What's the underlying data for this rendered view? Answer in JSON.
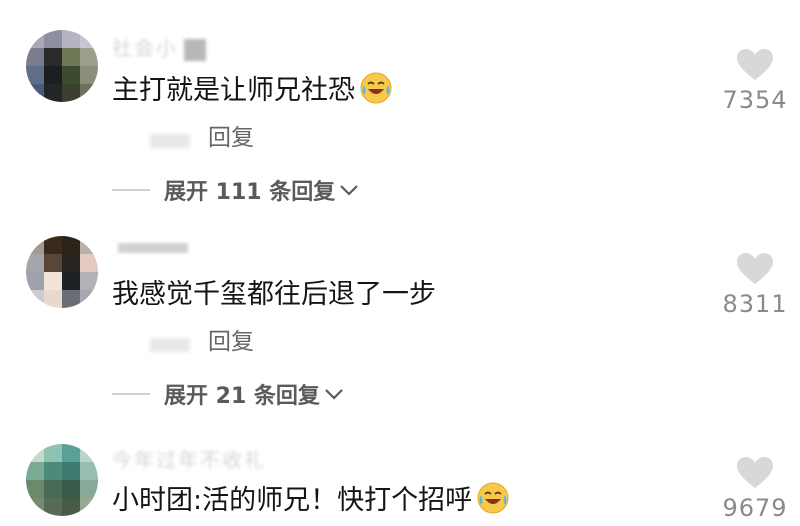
{
  "comments": [
    {
      "username": "社会小",
      "text": "主打就是让师兄社恐",
      "emoji": "laugh-cry-emoji",
      "likes": "7354",
      "reply_label": "回复",
      "expand_label": "展开 111 条回复"
    },
    {
      "username": "",
      "text": "我感觉千玺都往后退了一步",
      "emoji": "",
      "likes": "8311",
      "reply_label": "回复",
      "expand_label": "展开 21 条回复"
    },
    {
      "username": "今年过年不收礼",
      "text": "小时团:活的师兄！快打个招呼",
      "emoji": "laugh-cry-emoji",
      "likes": "9679",
      "reply_label": "",
      "expand_label": ""
    }
  ],
  "colors": {
    "text": "#151515",
    "meta": "#8a8a8a",
    "like_icon": "#d8d8d8",
    "emoji_face": "#f7c948"
  }
}
